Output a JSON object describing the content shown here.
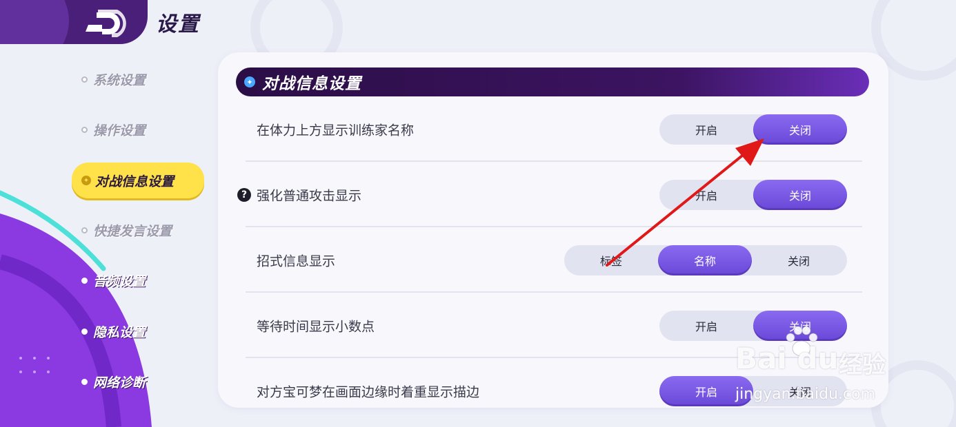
{
  "header": {
    "title": "设置"
  },
  "sidebar": {
    "items": [
      {
        "label": "系统设置"
      },
      {
        "label": "操作设置"
      },
      {
        "label": "对战信息设置"
      },
      {
        "label": "快捷发言设置"
      },
      {
        "label": "音频设置"
      },
      {
        "label": "隐私设置"
      },
      {
        "label": "网络诊断"
      }
    ]
  },
  "section": {
    "title": "对战信息设置",
    "rows": [
      {
        "label": "在体力上方显示训练家名称",
        "options": [
          "开启",
          "关闭"
        ],
        "selected": "关闭"
      },
      {
        "label": "强化普通攻击显示",
        "help_icon": "?",
        "options": [
          "开启",
          "关闭"
        ],
        "selected": "关闭"
      },
      {
        "label": "招式信息显示",
        "options": [
          "标签",
          "名称",
          "关闭"
        ],
        "selected": "名称"
      },
      {
        "label": "等待时间显示小数点",
        "options": [
          "开启",
          "关闭"
        ],
        "selected": "关闭"
      },
      {
        "label": "对方宝可梦在画面边缘时着重显示描边",
        "options": [
          "开启",
          "关闭"
        ],
        "selected": "开启"
      }
    ]
  },
  "watermark": {
    "brand": "Bai du",
    "cn": "经验",
    "url": "jingyan.baidu.com"
  },
  "colors": {
    "accent": "#7a58e4",
    "active_tab": "#ffe14a",
    "header": "#2b0e46",
    "annotation_arrow": "#e01818"
  }
}
